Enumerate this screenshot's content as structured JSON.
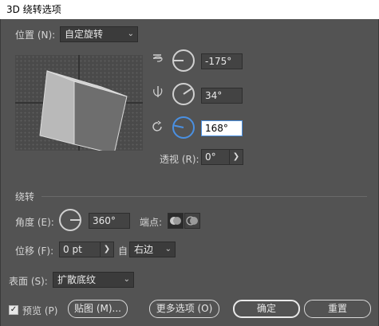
{
  "window": {
    "title": "3D 绕转选项"
  },
  "position": {
    "label": "位置 (N):",
    "value": "自定旋转"
  },
  "rotation": {
    "x": {
      "icon": "x-axis-rotate-icon",
      "value": "-175°"
    },
    "y": {
      "icon": "y-axis-rotate-icon",
      "value": "34°"
    },
    "z": {
      "icon": "z-axis-rotate-icon",
      "value": "168°"
    }
  },
  "perspective": {
    "label": "透视 (R):",
    "value": "0°"
  },
  "revolve": {
    "section_label": "绕转",
    "angle_label": "角度 (E):",
    "angle_value": "360°",
    "cap_label": "端点:",
    "offset_label": "位移 (F):",
    "offset_value": "0 pt",
    "from_label": "自",
    "from_value": "右边"
  },
  "surface": {
    "label": "表面 (S):",
    "value": "扩散底纹"
  },
  "footer": {
    "preview_label": "预览 (P)",
    "preview_checked": true,
    "map_button": "贴图 (M)...",
    "more_button": "更多选项 (O)",
    "ok_button": "确定",
    "reset_button": "重置"
  },
  "colors": {
    "accent": "#4a90e2",
    "panel": "#535353"
  }
}
